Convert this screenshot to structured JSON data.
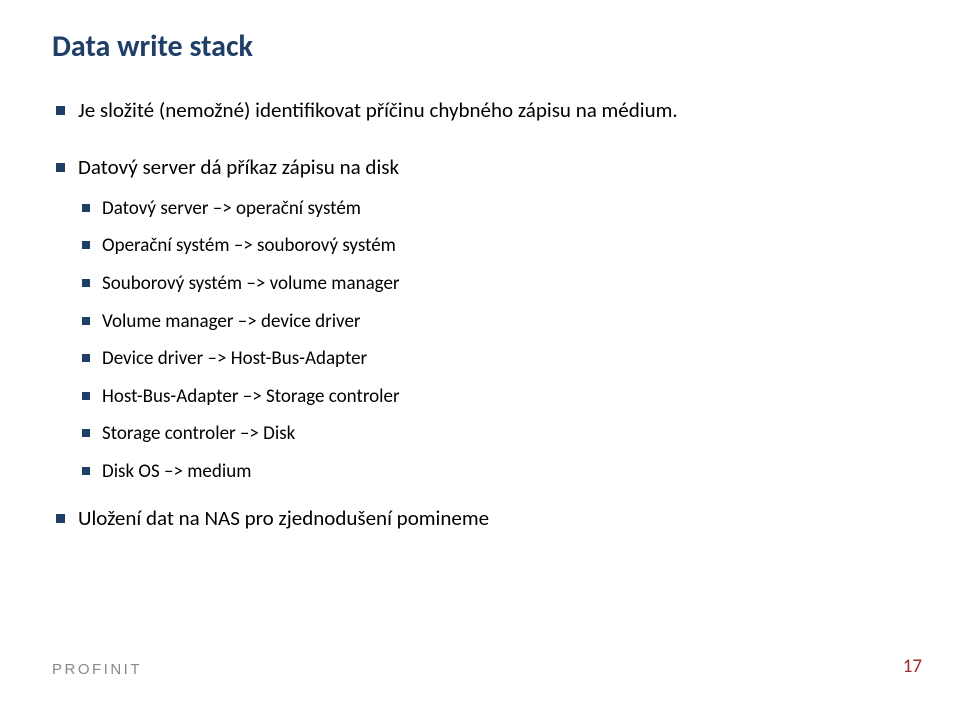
{
  "title": "Data write stack",
  "items": [
    "Je složité (nemožné) identifikovat příčinu chybného zápisu na médium.",
    "Datový server dá příkaz zápisu na disk",
    "Uložení dat na NAS pro zjednodušení pomineme"
  ],
  "subitems": [
    "Datový server –> operační systém",
    "Operační systém –> souborový systém",
    "Souborový systém –> volume manager",
    "Volume manager –> device driver",
    "Device driver –> Host-Bus-Adapter",
    "Host-Bus-Adapter –> Storage controler",
    "Storage controler –> Disk",
    "Disk OS –> medium"
  ],
  "footer": {
    "logo": "PROFINIT",
    "page": "17"
  }
}
